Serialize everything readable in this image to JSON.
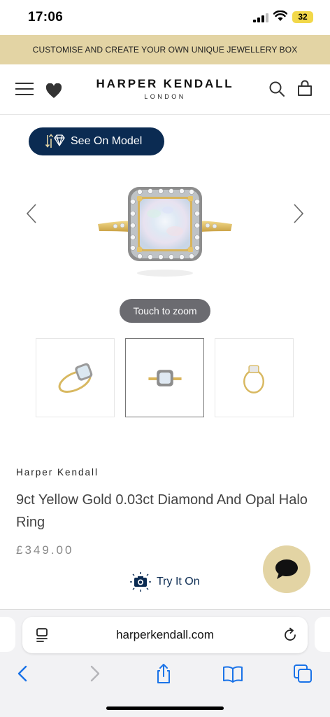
{
  "status_bar": {
    "time": "17:06",
    "battery": "32"
  },
  "promo": {
    "text": "CUSTOMISE AND CREATE YOUR OWN UNIQUE JEWELLERY BOX"
  },
  "header": {
    "logo_main": "HARPER KENDALL",
    "logo_sub": "LONDON",
    "icons": [
      "menu-icon",
      "heart-icon",
      "search-icon",
      "bag-icon"
    ]
  },
  "gallery": {
    "see_on_model": "See On Model",
    "zoom_hint": "Touch to zoom",
    "thumbnails": [
      "ring-angled",
      "ring-front",
      "ring-side"
    ],
    "active_thumbnail": 1
  },
  "product": {
    "brand": "Harper Kendall",
    "title": "9ct Yellow Gold 0.03ct Diamond And Opal Halo Ring",
    "price": "£349.00",
    "try_it_on": "Try It On"
  },
  "browser": {
    "url": "harperkendall.com",
    "toolbar": [
      "back-icon",
      "forward-icon",
      "share-icon",
      "bookmarks-icon",
      "tabs-icon"
    ]
  },
  "colors": {
    "navy": "#0b2b52",
    "gold_banner": "#e3d4a4",
    "zoom_pill": "#6b6b70"
  }
}
